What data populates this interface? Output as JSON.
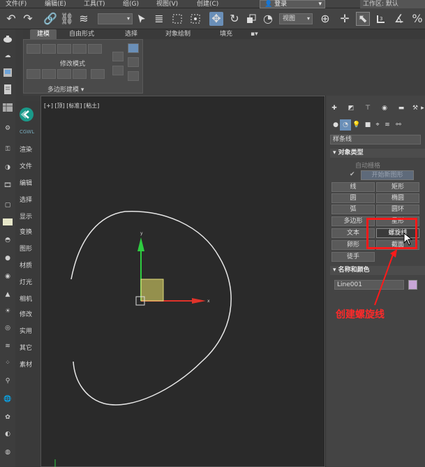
{
  "menubar": {
    "items": [
      "文件(F)",
      "编辑(E)",
      "工具(T)",
      "组(G)",
      "视图(V)",
      "创建(C)"
    ],
    "login": "登录",
    "workspace_label": "工作区: 默认"
  },
  "toolbar": {
    "selection_filter": "",
    "coord_dropdown": "视图"
  },
  "ribbon": {
    "tabs": [
      "建模",
      "自由形式",
      "选择",
      "对象绘制",
      "填充"
    ],
    "panel_title": "修改模式",
    "footer": "多边形建模 ▾"
  },
  "leftbar": {
    "labels": [
      "CGWL",
      "渲染",
      "文件",
      "编辑",
      "选择",
      "显示",
      "变换",
      "图形",
      "材质",
      "灯光",
      "相机",
      "修改",
      "实用",
      "其它",
      "素材"
    ]
  },
  "viewport": {
    "label": "[+] [顶] [标准] [粘土]"
  },
  "cmdpanel": {
    "category": "样条线",
    "object_type_title": "对象类型",
    "auto_grid": "自动栅格",
    "start_shape": "开始新图形",
    "buttons": [
      [
        "线",
        "矩形"
      ],
      [
        "圆",
        "椭圆"
      ],
      [
        "弧",
        "圆环"
      ],
      [
        "多边形",
        "星形"
      ],
      [
        "文本",
        "螺旋线"
      ],
      [
        "卵形",
        "截面"
      ],
      [
        "徒手",
        ""
      ]
    ],
    "name_color_title": "名称和颜色",
    "object_name": "Line001"
  },
  "annotation": {
    "text": "创建螺旋线"
  },
  "colors": {
    "highlight": "#ff1a1a",
    "gizmo_y": "#2ecc40",
    "gizmo_x": "#e0332a",
    "gizmo_plane": "#d4d06a"
  }
}
